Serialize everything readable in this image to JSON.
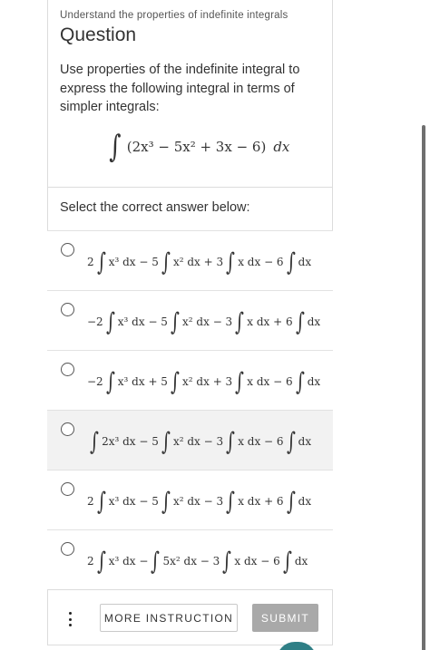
{
  "header": {
    "breadcrumb": "Understand the properties of indefinite integrals",
    "title": "Question"
  },
  "question": {
    "prompt": "Use properties of the indefinite integral to express the following integral in terms of simpler integrals:",
    "integral_sign": "∫",
    "integrand": "(2x³ − 5x² + 3x − 6)",
    "differential": "dx"
  },
  "answers": {
    "label": "Select the correct answer below:",
    "integral_sign": "∫",
    "options": [
      {
        "parts": [
          "2",
          " x³ dx − 5",
          " x² dx + 3",
          " x dx − 6",
          " dx"
        ],
        "shaded": false
      },
      {
        "parts": [
          "−2",
          " x³ dx − 5",
          " x² dx − 3",
          " x dx + 6",
          " dx"
        ],
        "shaded": false
      },
      {
        "parts": [
          "−2",
          " x³ dx + 5",
          " x² dx + 3",
          " x dx − 6",
          " dx"
        ],
        "shaded": false
      },
      {
        "parts": [
          "",
          " 2x³ dx − 5",
          " x² dx − 3",
          " x dx − 6",
          " dx"
        ],
        "shaded": true
      },
      {
        "parts": [
          "2",
          " x³ dx − 5",
          " x² dx − 3",
          " x dx + 6",
          " dx"
        ],
        "shaded": false
      },
      {
        "parts": [
          "2",
          " x³ dx −",
          " 5x² dx − 3",
          " x dx − 6",
          " dx"
        ],
        "shaded": false
      }
    ]
  },
  "footer": {
    "more_label": "MORE INSTRUCTION",
    "submit_label": "SUBMIT"
  },
  "colors": {
    "submit_bg": "#a9a9a9",
    "shaded_option_bg": "#f2f2f2",
    "accent_teal": "#2f7f86"
  },
  "icons": {
    "menu": "kebab-menu-icon",
    "radio": "radio-unselected-icon"
  }
}
